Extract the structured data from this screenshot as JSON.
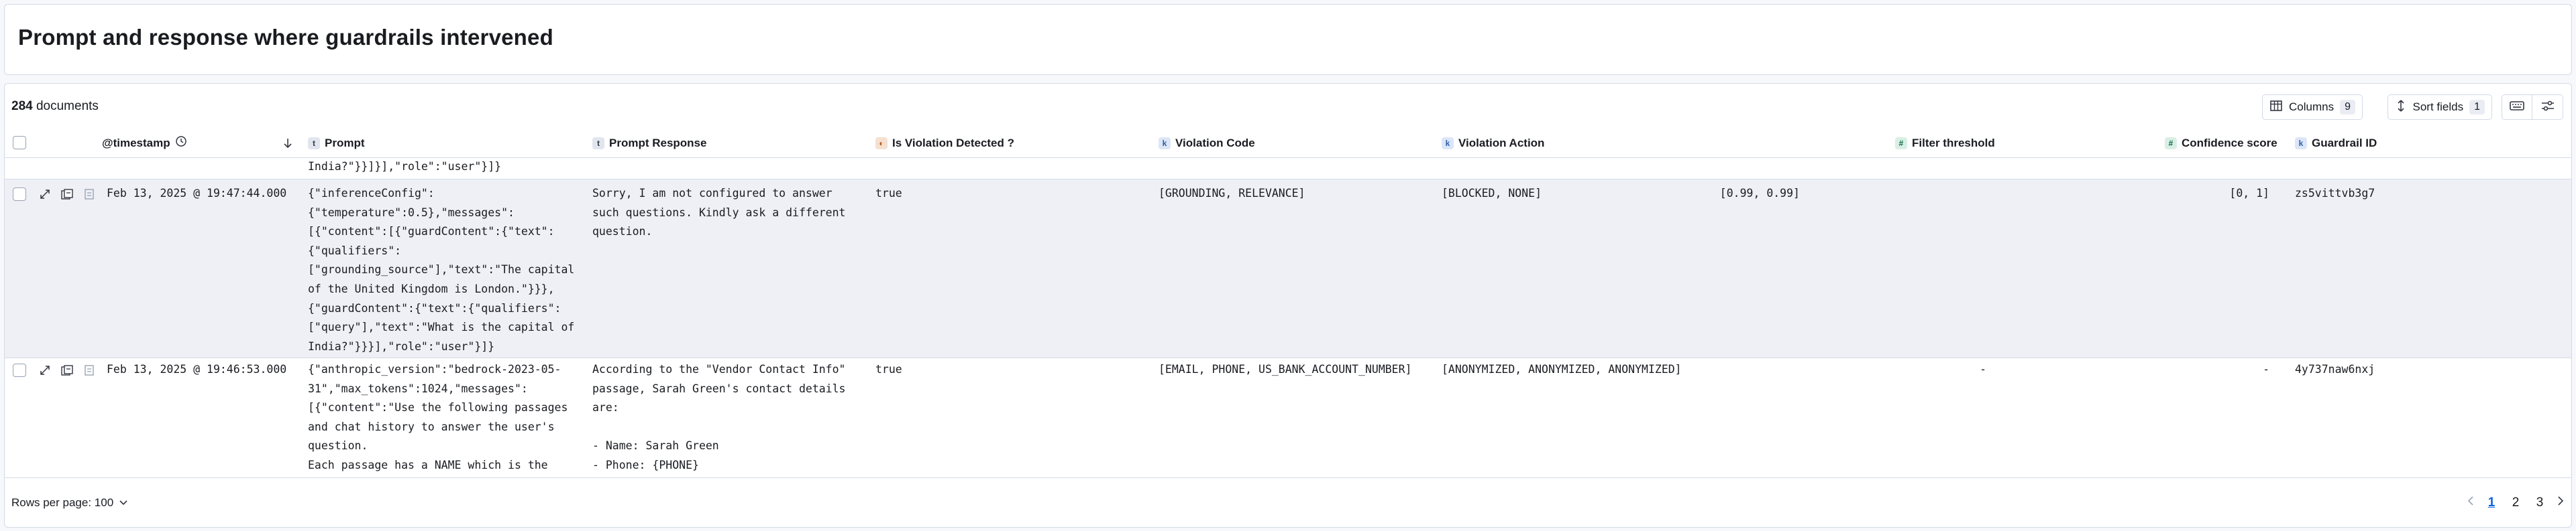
{
  "panel_title": "Prompt and response where guardrails intervened",
  "toolbar": {
    "doc_count": "284",
    "doc_count_label": "documents",
    "columns_label": "Columns",
    "columns_count": "9",
    "sort_label": "Sort fields",
    "sort_count": "1"
  },
  "columns": {
    "timestamp": "@timestamp",
    "prompt": "Prompt",
    "prompt_response": "Prompt Response",
    "is_violation": "Is Violation Detected ?",
    "violation_code": "Violation Code",
    "violation_action": "Violation Action",
    "filter_threshold": "Filter threshold",
    "confidence_score": "Confidence score",
    "guardrail_id": "Guardrail ID"
  },
  "type_tokens": {
    "text": "t",
    "keyword": "k",
    "number": "#",
    "boolean": "◐"
  },
  "rows": {
    "partial": {
      "prompt": "India?\"}}]}],\"role\":\"user\"}]}"
    },
    "r1": {
      "timestamp": "Feb 13, 2025 @ 19:47:44.000",
      "prompt": "{\"inferenceConfig\":\n{\"temperature\":0.5},\"messages\":\n[{\"content\":[{\"guardContent\":{\"text\":\n{\"qualifiers\":\n[\"grounding_source\"],\"text\":\"The capital\nof the United Kingdom is London.\"}}},\n{\"guardContent\":{\"text\":{\"qualifiers\":\n[\"query\"],\"text\":\"What is the capital of\nIndia?\"}}}],\"role\":\"user\"}]}",
      "response": "Sorry, I am not configured to answer\nsuch questions. Kindly ask a different\nquestion.",
      "is_violation": "true",
      "violation_code": "[GROUNDING, RELEVANCE]",
      "violation_action": "[BLOCKED, NONE]",
      "filter_threshold": "[0.99, 0.99]",
      "confidence_score": "[0, 1]",
      "guardrail_id": "zs5vittvb3g7"
    },
    "r2": {
      "timestamp": "Feb 13, 2025 @ 19:46:53.000",
      "prompt": "{\"anthropic_version\":\"bedrock-2023-05-\n31\",\"max_tokens\":1024,\"messages\":\n[{\"content\":\"Use the following passages\nand chat history to answer the user's\nquestion.\nEach passage has a NAME which is the\ntitle of the document. After your",
      "response": "According to the \"Vendor Contact Info\"\npassage, Sarah Green's contact details\nare:\n\n- Name: Sarah Green\n- Phone: {PHONE}\n- Email: {EMAIL}",
      "is_violation": "true",
      "violation_code": "[EMAIL, PHONE, US_BANK_ACCOUNT_NUMBER]",
      "violation_action": "[ANONYMIZED, ANONYMIZED, ANONYMIZED]",
      "filter_threshold": "-",
      "confidence_score": "-",
      "guardrail_id": "4y737naw6nxj"
    }
  },
  "footer": {
    "rows_per_page": "Rows per page: 100",
    "pages": [
      "1",
      "2",
      "3"
    ],
    "current_page": "1"
  }
}
